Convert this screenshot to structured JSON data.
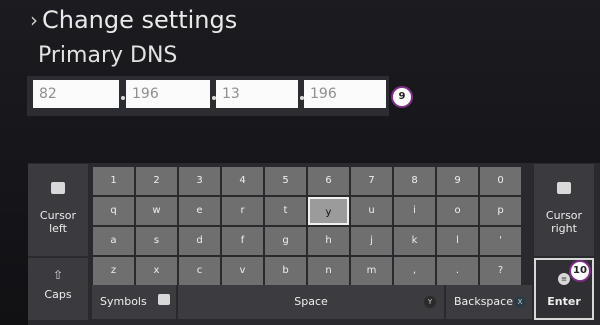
{
  "header": {
    "breadcrumb": "Change settings",
    "subtitle": "Primary DNS"
  },
  "dns": {
    "octets": [
      "82",
      "196",
      "13",
      "196"
    ],
    "badge": "9"
  },
  "keyboard": {
    "rows": [
      [
        "1",
        "2",
        "3",
        "4",
        "5",
        "6",
        "7",
        "8",
        "9",
        "0"
      ],
      [
        "q",
        "w",
        "e",
        "r",
        "t",
        "y",
        "u",
        "i",
        "o",
        "p"
      ],
      [
        "a",
        "s",
        "d",
        "f",
        "g",
        "h",
        "j",
        "k",
        "l",
        "'"
      ],
      [
        "z",
        "x",
        "c",
        "v",
        "b",
        "n",
        "m",
        ",",
        ".",
        "?"
      ]
    ],
    "selected_key": "y",
    "left": {
      "cursor_left_line1": "Cursor",
      "cursor_left_line2": "left",
      "caps": "Caps"
    },
    "right": {
      "cursor_right_line1": "Cursor",
      "cursor_right_line2": "right",
      "enter": "Enter",
      "enter_badge": "10"
    },
    "bottom": {
      "symbols": "Symbols",
      "space": "Space",
      "backspace": "Backspace",
      "space_button_glyph": "Y",
      "backspace_button_glyph": "X"
    }
  },
  "colors": {
    "badge_border": "#7e2f86",
    "selected_key": "#9b9b9b"
  }
}
